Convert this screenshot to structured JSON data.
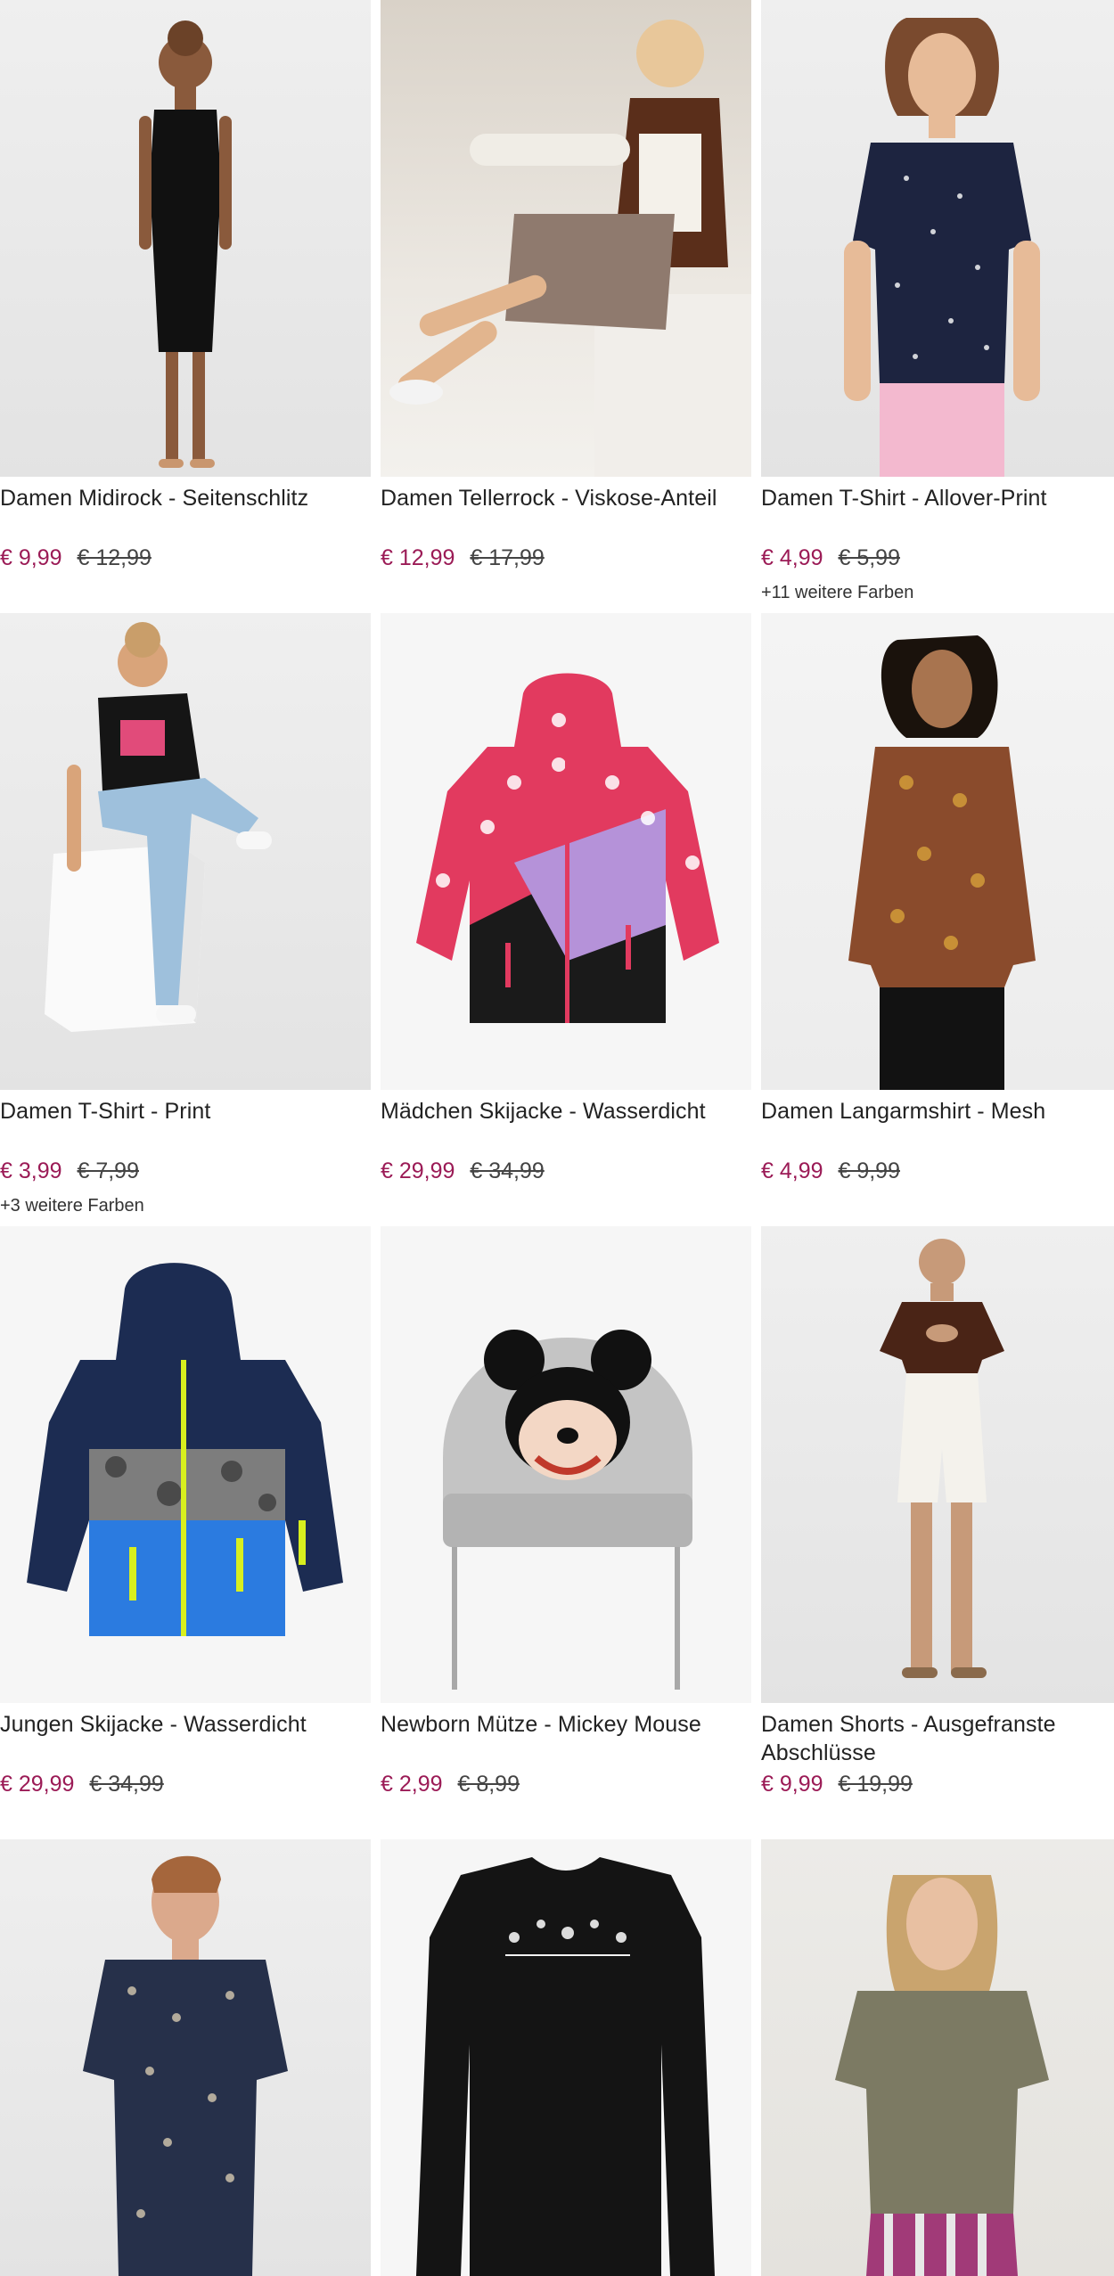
{
  "products": [
    {
      "title": "Damen Midirock - Seitenschlitz",
      "price": "€ 9,99",
      "old_price": "€ 12,99",
      "more": "",
      "figure": "dress",
      "color": "#111111"
    },
    {
      "title": "Damen Tellerrock - Viskose-Anteil",
      "price": "€ 12,99",
      "old_price": "€ 17,99",
      "more": "",
      "figure": "skirt",
      "color": "#6b4a3a"
    },
    {
      "title": "Damen T-Shirt - Allover-Print",
      "price": "€ 4,99",
      "old_price": "€ 5,99",
      "more": "+11 weitere Farben",
      "figure": "tshirt",
      "color": "#1d2440"
    },
    {
      "title": "Damen T-Shirt - Print",
      "price": "€ 3,99",
      "old_price": "€ 7,99",
      "more": "+3 weitere Farben",
      "figure": "sitting",
      "color": "#111111"
    },
    {
      "title": "Mädchen Skijacke - Wasserdicht",
      "price": "€ 29,99",
      "old_price": "€ 34,99",
      "more": "",
      "figure": "jacket-hearts",
      "color": "#b98fd6"
    },
    {
      "title": "Damen Langarmshirt - Mesh",
      "price": "€ 4,99",
      "old_price": "€ 9,99",
      "more": "",
      "figure": "longsleeve",
      "color": "#8a4b2c"
    },
    {
      "title": "Jungen Skijacke - Wasserdicht",
      "price": "€ 29,99",
      "old_price": "€ 34,99",
      "more": "",
      "figure": "jacket-camo",
      "color": "#1c2c52"
    },
    {
      "title": "Newborn Mütze - Mickey Mouse",
      "price": "€ 2,99",
      "old_price": "€ 8,99",
      "more": "",
      "figure": "beanie",
      "color": "#bdbdbd"
    },
    {
      "title": "Damen Shorts - Ausgefranste Abschlüsse",
      "price": "€ 9,99",
      "old_price": "€ 19,99",
      "more": "",
      "figure": "shorts",
      "color": "#f2f0ea"
    },
    {
      "title": "",
      "price": "",
      "old_price": "",
      "more": "",
      "figure": "shirt-man",
      "color": "#26304a"
    },
    {
      "title": "",
      "price": "",
      "old_price": "",
      "more": "",
      "figure": "longsleeve-black",
      "color": "#141414"
    },
    {
      "title": "",
      "price": "",
      "old_price": "",
      "more": "",
      "figure": "olive-shirt",
      "color": "#7c7a63"
    }
  ],
  "icons": {
    "product_image": "product-photo"
  }
}
